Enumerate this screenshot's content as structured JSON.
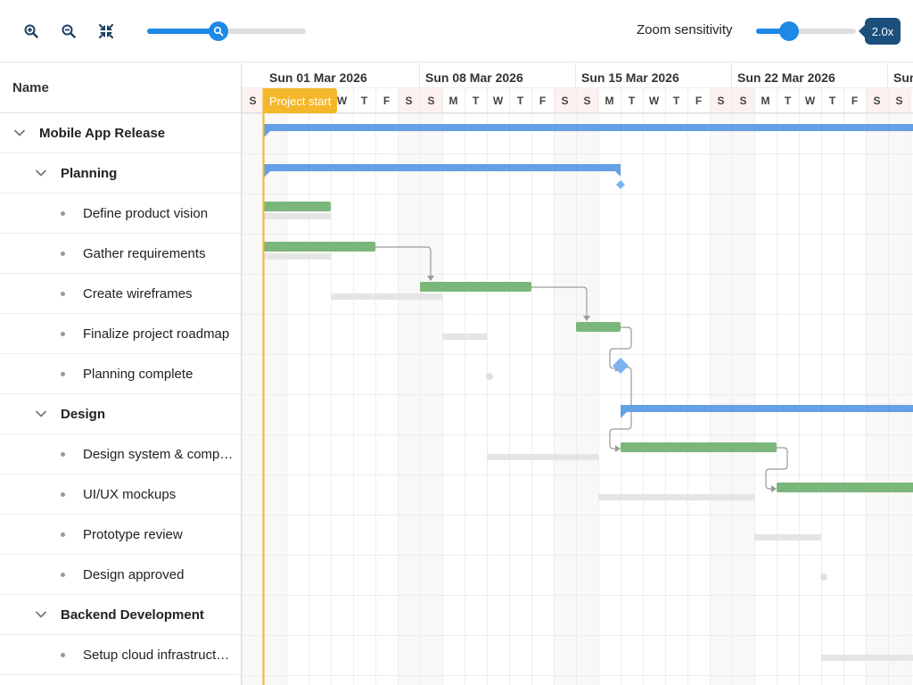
{
  "toolbar": {
    "zoom_in_icon": "zoom-in-icon",
    "zoom_out_icon": "zoom-out-icon",
    "fit_icon": "zoom-to-fit-icon",
    "zoom_level": 0.45,
    "sensitivity_label": "Zoom sensitivity",
    "sensitivity_fraction": 0.33,
    "sensitivity_value": "2.0x"
  },
  "grid": {
    "header": "Name",
    "rows": [
      {
        "label": "Mobile App Release",
        "type": "parent",
        "level": 0
      },
      {
        "label": "Planning",
        "type": "parent",
        "level": 1
      },
      {
        "label": "Define product vision",
        "type": "task",
        "level": 2
      },
      {
        "label": "Gather requirements",
        "type": "task",
        "level": 2
      },
      {
        "label": "Create wireframes",
        "type": "task",
        "level": 2
      },
      {
        "label": "Finalize project roadmap",
        "type": "task",
        "level": 2
      },
      {
        "label": "Planning complete",
        "type": "milestone",
        "level": 2
      },
      {
        "label": "Design",
        "type": "parent",
        "level": 1
      },
      {
        "label": "Design system & components",
        "type": "task",
        "level": 2
      },
      {
        "label": "UI/UX mockups",
        "type": "task",
        "level": 2
      },
      {
        "label": "Prototype review",
        "type": "task",
        "level": 2
      },
      {
        "label": "Design approved",
        "type": "milestone",
        "level": 2
      },
      {
        "label": "Backend Development",
        "type": "parent",
        "level": 1
      },
      {
        "label": "Setup cloud infrastructure",
        "type": "task",
        "level": 2
      }
    ]
  },
  "timeline": {
    "weeks": [
      "Sun 01 Mar 2026",
      "Sun 08 Mar 2026",
      "Sun 15 Mar 2026",
      "Sun 22 Mar 2026",
      "Sun"
    ],
    "day_letters": [
      "S",
      "M",
      "T",
      "W",
      "T",
      "F",
      "S"
    ],
    "project_start_label": "Project start",
    "colors": {
      "summary": "#64a0e6",
      "task": "#7bb77b",
      "baseline": "#e5e5e5",
      "milestone": "#7ab4f0",
      "weekend_bg": "#f9f8f6",
      "project_line": "#f5b72a"
    },
    "bars": [
      {
        "row": 0,
        "kind": "summary",
        "start": 0,
        "end": 40
      },
      {
        "row": 1,
        "kind": "summary",
        "start": 0,
        "end": 16
      },
      {
        "row": 1,
        "kind": "milestone",
        "start": 16
      },
      {
        "row": 2,
        "kind": "task",
        "start": 0,
        "end": 3
      },
      {
        "row": 2,
        "kind": "baseline",
        "start": 0,
        "end": 3
      },
      {
        "row": 3,
        "kind": "task",
        "start": 0,
        "end": 5
      },
      {
        "row": 3,
        "kind": "baseline",
        "start": 0,
        "end": 3
      },
      {
        "row": 4,
        "kind": "task",
        "start": 7,
        "end": 12
      },
      {
        "row": 4,
        "kind": "baseline",
        "start": 3,
        "end": 8
      },
      {
        "row": 5,
        "kind": "task",
        "start": 14,
        "end": 16
      },
      {
        "row": 5,
        "kind": "baseline",
        "start": 8,
        "end": 10
      },
      {
        "row": 6,
        "kind": "milestone",
        "start": 16
      },
      {
        "row": 6,
        "kind": "baseline-dot",
        "start": 10
      },
      {
        "row": 7,
        "kind": "summary",
        "start": 16,
        "end": 40
      },
      {
        "row": 8,
        "kind": "task",
        "start": 16,
        "end": 23
      },
      {
        "row": 8,
        "kind": "baseline",
        "start": 10,
        "end": 15
      },
      {
        "row": 9,
        "kind": "task",
        "start": 23,
        "end": 32
      },
      {
        "row": 9,
        "kind": "baseline",
        "start": 15,
        "end": 22
      },
      {
        "row": 10,
        "kind": "baseline",
        "start": 22,
        "end": 25
      },
      {
        "row": 11,
        "kind": "baseline-dot",
        "start": 25
      },
      {
        "row": 13,
        "kind": "baseline",
        "start": 25,
        "end": 30
      }
    ],
    "links": [
      {
        "from_row": 3,
        "from_day": 5,
        "to_row": 4,
        "to_day": 7
      },
      {
        "from_row": 4,
        "from_day": 12,
        "to_row": 5,
        "to_day": 14
      },
      {
        "from_row": 5,
        "from_day": 16,
        "to_row": 6,
        "to_day": 16
      },
      {
        "from_row": 6,
        "from_day": 16,
        "to_row": 8,
        "to_day": 16
      },
      {
        "from_row": 8,
        "from_day": 23,
        "to_row": 9,
        "to_day": 23
      }
    ]
  }
}
